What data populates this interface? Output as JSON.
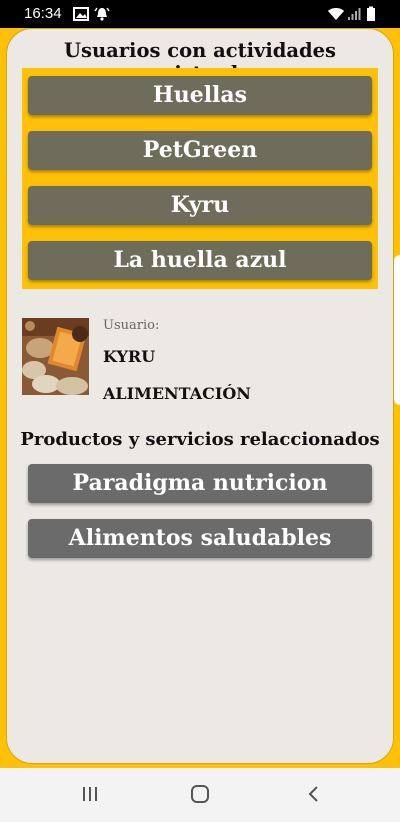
{
  "status_bar": {
    "time": "16:34",
    "left_icons": [
      "image-icon",
      "alarm-bell-icon"
    ],
    "right_icons": [
      "wifi-icon",
      "signal-icon",
      "battery-icon"
    ]
  },
  "header": {
    "title": "Usuarios con actividades registradas"
  },
  "users": [
    {
      "label": "Huellas"
    },
    {
      "label": "PetGreen"
    },
    {
      "label": "Kyru"
    },
    {
      "label": "La huella azul"
    }
  ],
  "profile": {
    "user_label": "Usuario:",
    "name": "KYRU",
    "category": "ALIMENTACIÓN"
  },
  "related": {
    "title": "Productos y servicios relaccionados",
    "items": [
      {
        "label": "Paradigma nutricion"
      },
      {
        "label": "Alimentos saludables"
      }
    ]
  },
  "nav_bar": {
    "icons": [
      "recent-apps-icon",
      "home-icon",
      "back-icon"
    ]
  },
  "colors": {
    "accent": "#ffc107",
    "olive_button": "#6e6c5a",
    "grey_button": "#6b6b6b",
    "card_bg": "#ece8e4"
  }
}
